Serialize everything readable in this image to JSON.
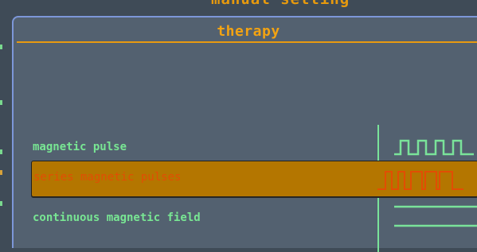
{
  "background_title": "manual setting",
  "dialog": {
    "title": "therapy",
    "options": [
      {
        "label": "magnetic pulse",
        "icon": "single-pulse-wave-icon",
        "selected": false
      },
      {
        "label": "series magnetic pulses",
        "icon": "series-pulse-wave-icon",
        "selected": true
      },
      {
        "label": "continuous magnetic field",
        "icon": "continuous-field-icon",
        "selected": false
      }
    ]
  },
  "colors": {
    "background": "#3f4b57",
    "panel": "#536170",
    "accent": "#f3a312",
    "border": "#7d97d8",
    "option_text": "#78e693",
    "selected_fill": "#b47600",
    "selected_text": "#e14e04"
  }
}
